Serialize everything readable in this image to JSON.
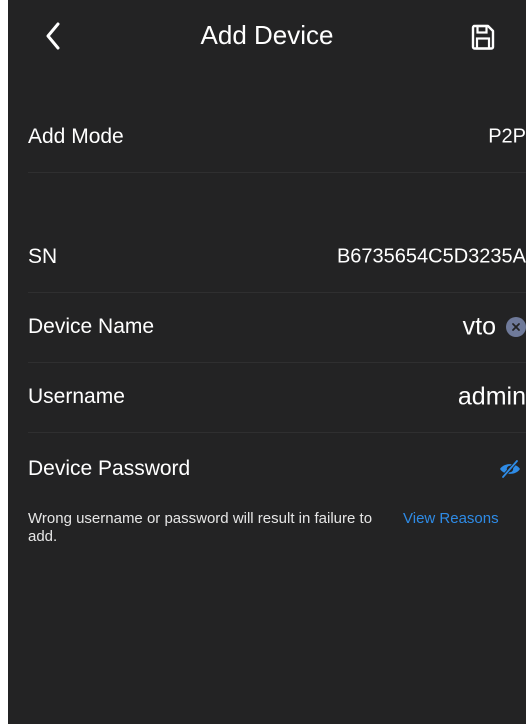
{
  "header": {
    "title": "Add Device"
  },
  "rows": {
    "add_mode": {
      "label": "Add Mode",
      "value": "P2P"
    },
    "sn": {
      "label": "SN",
      "value": "B6735654C5D3235A"
    },
    "device_name": {
      "label": "Device Name",
      "value": "vto"
    },
    "username": {
      "label": "Username",
      "value": "admin"
    },
    "password": {
      "label": "Device Password",
      "value": ""
    }
  },
  "hint": {
    "text": "Wrong username or password will result in failure to add.",
    "link": "View Reasons"
  },
  "icons": {
    "back": "chevron-left-icon",
    "save": "floppy-disk-icon",
    "clear": "clear-circle-icon",
    "visibility": "eye-slash-icon"
  },
  "colors": {
    "background": "#232324",
    "text": "#ffffff",
    "link": "#2e8be6",
    "clear_button": "#6f7a9a"
  }
}
